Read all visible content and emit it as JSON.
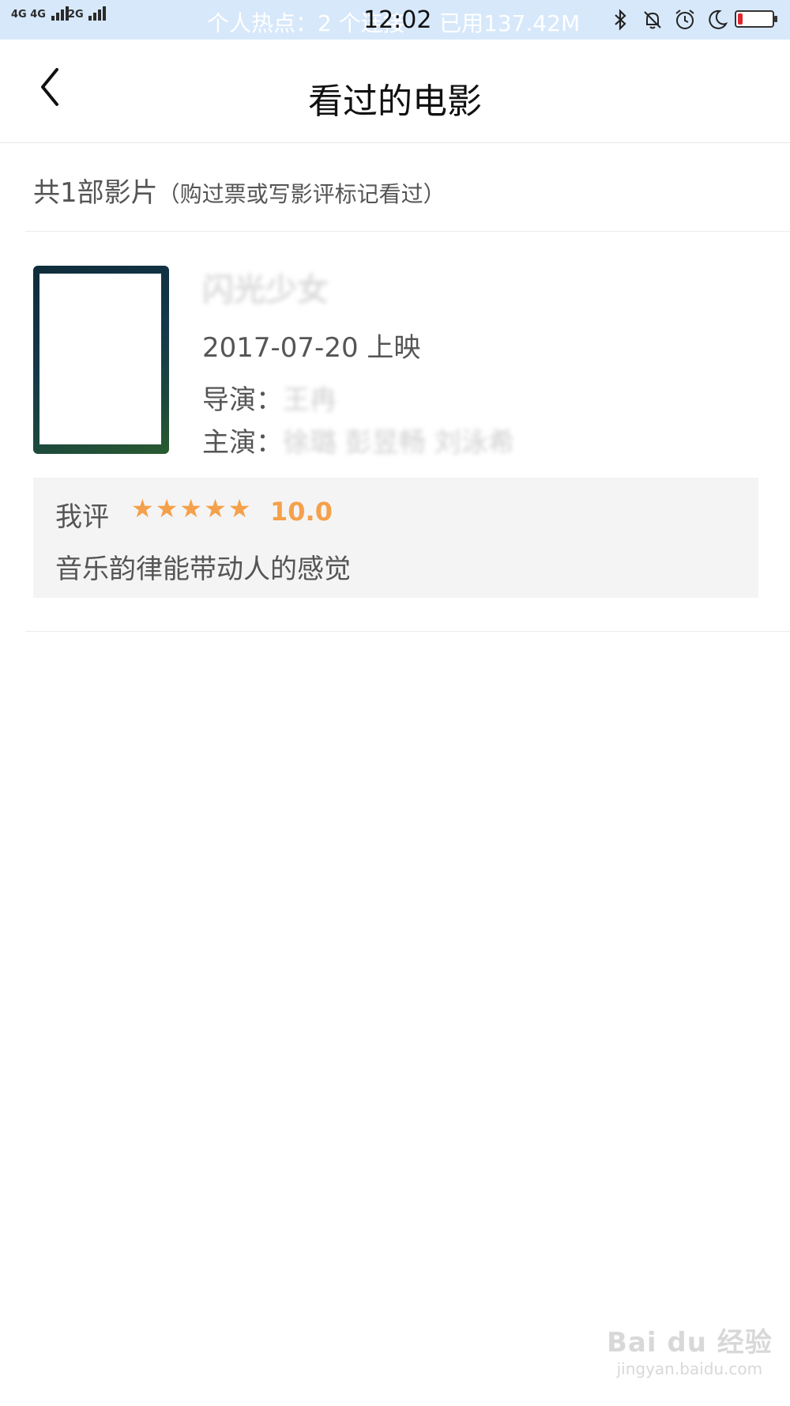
{
  "status_bar": {
    "signal_1": "4G 4G",
    "signal_2": "2G",
    "hotspot": "个人热点：2 个连接",
    "time": "12:02",
    "data_used": "已用137.42M",
    "battery_level_pct": 15,
    "battery_color": "#e0262f",
    "icons": [
      "bluetooth-icon",
      "bell-muted-icon",
      "alarm-icon",
      "moon-icon"
    ]
  },
  "header": {
    "title": "看过的电影",
    "back_icon": "chevron-left-icon"
  },
  "summary": {
    "count_text": "共1部影片",
    "hint": "（购过票或写影评标记看过）"
  },
  "movie": {
    "title": "闪光少女",
    "release": "2017-07-20 上映",
    "director_label": "导演：",
    "director": "王冉",
    "actors_label": "主演：",
    "actors": "徐璐 彭昱畅 刘泳希"
  },
  "review": {
    "label": "我评",
    "stars": "★★★★★",
    "rating": 5,
    "score": "10.0",
    "comment": "音乐韵律能带动人的感觉",
    "accent_color": "#f5a04a"
  },
  "watermark": {
    "brand": "Bai du 经验",
    "url": "jingyan.baidu.com"
  }
}
